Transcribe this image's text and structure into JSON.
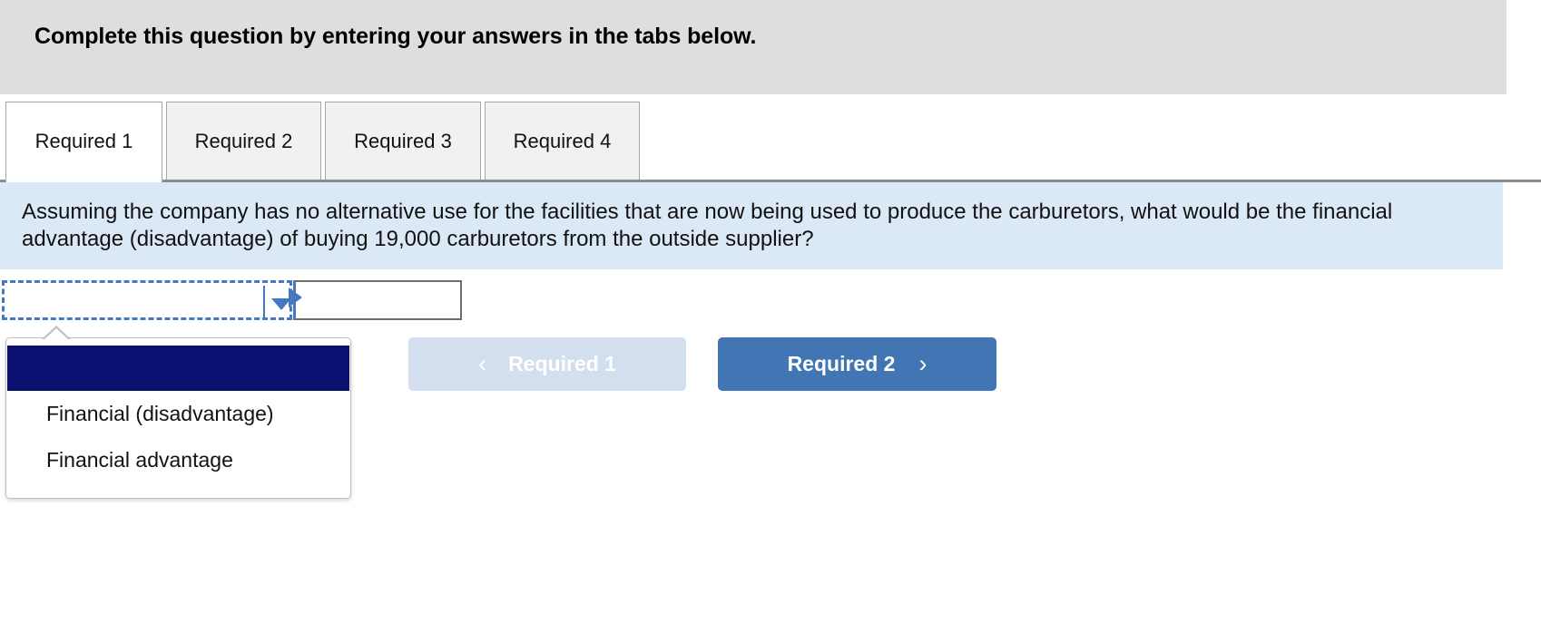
{
  "header": {
    "title": "Complete this question by entering your answers in the tabs below."
  },
  "tabs": [
    {
      "label": "Required 1",
      "active": true
    },
    {
      "label": "Required 2",
      "active": false
    },
    {
      "label": "Required 3",
      "active": false
    },
    {
      "label": "Required 4",
      "active": false
    }
  ],
  "question": {
    "text": "Assuming the company has no alternative use for the facilities that are now being used to produce the carburetors, what would be the financial advantage (disadvantage) of buying 19,000 carburetors from the outside supplier?"
  },
  "answer": {
    "select_value": "",
    "select_placeholder": "",
    "amount_value": "",
    "amount_placeholder": "",
    "caret_icon": "chevron-down-icon",
    "cursor_icon": "pointer-arrow-icon"
  },
  "dropdown": {
    "open": true,
    "options": [
      {
        "label": "",
        "selected": true
      },
      {
        "label": "Financial (disadvantage)",
        "selected": false
      },
      {
        "label": "Financial advantage",
        "selected": false
      }
    ]
  },
  "navigation": {
    "prev_label": "Required 1",
    "prev_chevron": "‹",
    "prev_icon": "chevron-left-icon",
    "prev_disabled": true,
    "next_label": "Required 2",
    "next_chevron": "›",
    "next_icon": "chevron-right-icon",
    "next_disabled": false
  },
  "colors": {
    "header_bg": "#dedede",
    "question_bg": "#dbe8f6",
    "tab_active_bg": "#ffffff",
    "tab_inactive_bg": "#f1f1f1",
    "accent_blue": "#4678bf",
    "next_button_bg": "#4175b4",
    "prev_button_bg": "#d3dfee",
    "option_highlight": "#0b1170"
  }
}
